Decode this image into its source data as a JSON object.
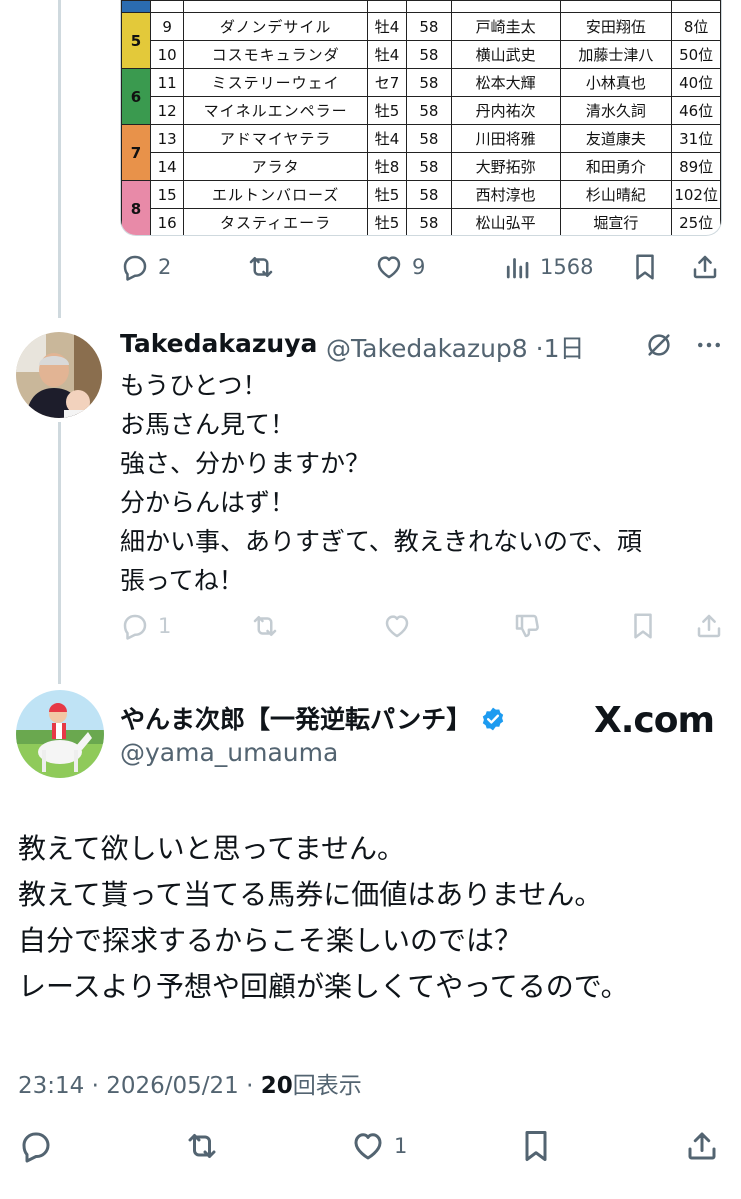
{
  "race_table": {
    "top_row": {
      "waku": "",
      "num": "",
      "name": "",
      "sex": "",
      "weight": "",
      "jockey": "",
      "trainer": "",
      "rank": ""
    },
    "rows": [
      {
        "waku": "5",
        "num": "9",
        "name": "ダノンデサイル",
        "sex": "牡4",
        "weight": "58",
        "jockey": "戸崎圭太",
        "trainer": "安田翔伍",
        "rank": "8位"
      },
      {
        "waku": "5",
        "num": "10",
        "name": "コスモキュランダ",
        "sex": "牡4",
        "weight": "58",
        "jockey": "横山武史",
        "trainer": "加藤士津八",
        "rank": "50位"
      },
      {
        "waku": "6",
        "num": "11",
        "name": "ミステリーウェイ",
        "sex": "セ7",
        "weight": "58",
        "jockey": "松本大輝",
        "trainer": "小林真也",
        "rank": "40位"
      },
      {
        "waku": "6",
        "num": "12",
        "name": "マイネルエンペラー",
        "sex": "牡5",
        "weight": "58",
        "jockey": "丹内祐次",
        "trainer": "清水久詞",
        "rank": "46位"
      },
      {
        "waku": "7",
        "num": "13",
        "name": "アドマイヤテラ",
        "sex": "牡4",
        "weight": "58",
        "jockey": "川田将雅",
        "trainer": "友道康夫",
        "rank": "31位"
      },
      {
        "waku": "7",
        "num": "14",
        "name": "アラタ",
        "sex": "牡8",
        "weight": "58",
        "jockey": "大野拓弥",
        "trainer": "和田勇介",
        "rank": "89位"
      },
      {
        "waku": "8",
        "num": "15",
        "name": "エルトンバローズ",
        "sex": "牡5",
        "weight": "58",
        "jockey": "西村淳也",
        "trainer": "杉山晴紀",
        "rank": "102位"
      },
      {
        "waku": "8",
        "num": "16",
        "name": "タスティエーラ",
        "sex": "牡5",
        "weight": "58",
        "jockey": "松山弘平",
        "trainer": "堀宣行",
        "rank": "25位"
      }
    ],
    "waku_colors": {
      "5": "#e3c93a",
      "6": "#3a9a4f",
      "7": "#e8924a",
      "8": "#e88aa8"
    }
  },
  "tweet1_actions": {
    "replies": "2",
    "likes": "9",
    "views": "1568"
  },
  "reply": {
    "name": "Takedakazuya",
    "handle": "@Takedakazup8",
    "time": "·1日",
    "lines": [
      "もうひとつ！",
      "お馬さん見て！",
      "強さ、分かりますか？",
      "分からんはず！",
      "細かい事、ありすぎて、教えきれないので、頑",
      "張ってね！"
    ],
    "reply_count": "1"
  },
  "main": {
    "name": "やんま次郎【一発逆転パンチ】",
    "handle": "@yama_umauma",
    "watermark": "X.com",
    "lines": [
      "教えて欲しいと思ってません。",
      "教えて貰って当てる馬券に価値はありません。",
      "自分で探求するからこそ楽しいのでは？",
      "レースより予想や回顧が楽しくてやってるので。"
    ],
    "time": "23:14 · 2026/05/21 · ",
    "views_count": "20",
    "views_label": "回表示",
    "like_count": "1"
  },
  "colors": {
    "accent": "#1d9bf0",
    "secondary_text": "#536471",
    "divider": "#cfd9de"
  },
  "icons": [
    "reply-icon",
    "retweet-icon",
    "like-icon",
    "views-icon",
    "bookmark-icon",
    "share-icon",
    "grok-icon",
    "more-icon",
    "verified-icon",
    "dislike-icon"
  ]
}
